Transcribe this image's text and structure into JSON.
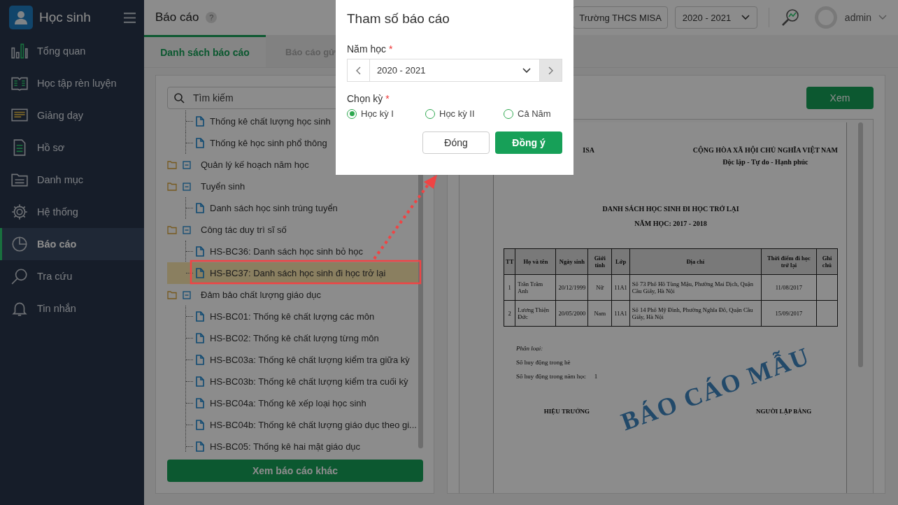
{
  "app": {
    "title": "Học sinh"
  },
  "sidebar": {
    "items": [
      {
        "label": "Tổng quan",
        "selected": false
      },
      {
        "label": "Học tập rèn luyện",
        "selected": false
      },
      {
        "label": "Giảng dạy",
        "selected": false
      },
      {
        "label": "Hồ sơ",
        "selected": false
      },
      {
        "label": "Danh mục",
        "selected": false
      },
      {
        "label": "Hệ thống",
        "selected": false
      },
      {
        "label": "Báo cáo",
        "selected": true
      },
      {
        "label": "Tra cứu",
        "selected": false
      },
      {
        "label": "Tin nhắn",
        "selected": false
      }
    ]
  },
  "header": {
    "title": "Báo cáo",
    "help": "?",
    "school": "Trường THCS MISA",
    "year": "2020 - 2021",
    "user": "admin"
  },
  "tabs": [
    {
      "label": "Danh sách báo cáo",
      "selected": true
    },
    {
      "label": "Báo cáo gử",
      "selected": false
    }
  ],
  "report_list": {
    "search": {
      "placeholder": "Tìm kiếm"
    },
    "tree": [
      {
        "kind": "report",
        "label": "Thống kê chất lượng học sinh",
        "selected": false
      },
      {
        "kind": "report",
        "label": "Thống kê học sinh phổ thông",
        "selected": false
      },
      {
        "kind": "folder",
        "label": "Quản lý kế hoạch năm học",
        "expanded": true
      },
      {
        "kind": "folder",
        "label": "Tuyển sinh",
        "expanded": true,
        "children": [
          {
            "kind": "report",
            "label": "Danh sách học sinh trúng tuyển",
            "selected": false
          }
        ]
      },
      {
        "kind": "folder",
        "label": "Công tác duy trì sĩ số",
        "expanded": true,
        "children": [
          {
            "kind": "report",
            "label": "HS-BC36: Danh sách học sinh bỏ học",
            "selected": false
          },
          {
            "kind": "report",
            "label": "HS-BC37: Danh sách học sinh đi học trở lại",
            "selected": true
          }
        ]
      },
      {
        "kind": "folder",
        "label": "Đảm bảo chất lượng giáo dục",
        "expanded": true,
        "children": [
          {
            "kind": "report",
            "label": "HS-BC01: Thống kê chất lượng các môn",
            "selected": false
          },
          {
            "kind": "report",
            "label": "HS-BC02: Thống kê chất lượng từng môn",
            "selected": false
          },
          {
            "kind": "report",
            "label": "HS-BC03a: Thống kê chất lượng kiểm tra giữa kỳ",
            "selected": false
          },
          {
            "kind": "report",
            "label": "HS-BC03b: Thống kê chất lượng kiểm tra cuối kỳ",
            "selected": false
          },
          {
            "kind": "report",
            "label": "HS-BC04a: Thống kê xếp loại học sinh",
            "selected": false
          },
          {
            "kind": "report",
            "label": "HS-BC04b: Thống kê chất lượng giáo dục theo gi...",
            "selected": false
          },
          {
            "kind": "report",
            "label": "HS-BC05: Thống kê hai mặt giáo dục",
            "selected": false
          }
        ]
      }
    ],
    "button": "Xem báo cáo khác"
  },
  "preview": {
    "button": "Xem",
    "document": {
      "org": "ISA",
      "nation": "CỘNG HÒA XÃ HỘI CHỦ NGHĨA VIỆT NAM",
      "motto": "Độc lập - Tự do - Hạnh phúc",
      "title": "DANH SÁCH HỌC SINH ĐI HỌC TRỞ LẠI",
      "subtitle": "NĂM HỌC: 2017 - 2018",
      "columns": [
        "TT",
        "Họ và tên",
        "Ngày sinh",
        "Giới tính",
        "Lớp",
        "Địa chỉ",
        "Thời điểm đi học trở lại",
        "Ghi chú"
      ],
      "rows": [
        [
          "1",
          "Trần Trâm Anh",
          "20/12/1999",
          "Nữ",
          "11A1",
          "Số 73 Phố Hồ Tùng Mậu, Phường Mai Dịch, Quận Cầu Giấy, Hà Nội",
          "11/08/2017",
          ""
        ],
        [
          "2",
          "Lương Thiện Đức",
          "20/05/2000",
          "Nam",
          "11A1",
          "Số 14 Phố Mỹ Đình, Phường Nghĩa Đô, Quận Cầu Giấy, Hà Nội",
          "15/09/2017",
          ""
        ]
      ],
      "summary_title": "Phân loại:",
      "summary": [
        {
          "label": "Số huy động trong hè"
        },
        {
          "label": "Số huy động trong năm học",
          "value": "1"
        }
      ],
      "signatures": [
        "HIỆU TRƯỞNG",
        "NGƯỜI LẬP BẢNG"
      ],
      "stamp": "BÁO CÁO MẪU"
    }
  },
  "dialog": {
    "title": "Tham số báo cáo",
    "year_label": "Năm học",
    "year_required": "*",
    "year": "2020 - 2021",
    "term_label": "Chọn kỳ",
    "term_required": "*",
    "terms": [
      {
        "label": "Học kỳ I",
        "selected": true
      },
      {
        "label": "Học kỳ II",
        "selected": false
      },
      {
        "label": "Cả Năm",
        "selected": false
      }
    ],
    "buttons": [
      {
        "label": "Đóng",
        "kind": "secondary"
      },
      {
        "label": "Đồng ý",
        "kind": "primary"
      }
    ]
  }
}
